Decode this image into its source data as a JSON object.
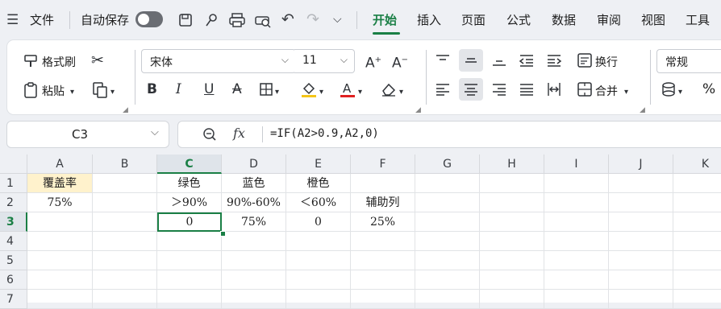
{
  "menubar": {
    "file_label": "文件",
    "autosave_label": "自动保存",
    "tabs": [
      {
        "label": "开始",
        "active": true
      },
      {
        "label": "插入"
      },
      {
        "label": "页面"
      },
      {
        "label": "公式"
      },
      {
        "label": "数据"
      },
      {
        "label": "审阅"
      },
      {
        "label": "视图"
      },
      {
        "label": "工具"
      }
    ],
    "accent_color": "#1a7f45"
  },
  "ribbon": {
    "format_painter_label": "格式刷",
    "paste_label": "粘贴",
    "font_name": "宋体",
    "font_size": "11",
    "wrap_label": "换行",
    "merge_label": "合并",
    "number_format": "常规",
    "percent_symbol": "%"
  },
  "formula_bar": {
    "name_box": "C3",
    "fx_label": "fx",
    "formula": "=IF(A2>0.9,A2,0)"
  },
  "sheet": {
    "columns": [
      "A",
      "B",
      "C",
      "D",
      "E",
      "F",
      "G",
      "H",
      "I",
      "J",
      "K"
    ],
    "rows": [
      "1",
      "2",
      "3",
      "4",
      "5",
      "6",
      "7"
    ],
    "selected_cell": "C3",
    "cells": {
      "A1": "覆盖率",
      "A2": "75%",
      "C1": "绿色",
      "D1": "蓝色",
      "E1": "橙色",
      "C2": "＞90%",
      "D2": "90%-60%",
      "E2": "＜60%",
      "F2": "辅助列",
      "C3": "0",
      "D3": "75%",
      "E3": "0",
      "F3": "25%"
    },
    "highlight_color": "#fff2cc"
  }
}
